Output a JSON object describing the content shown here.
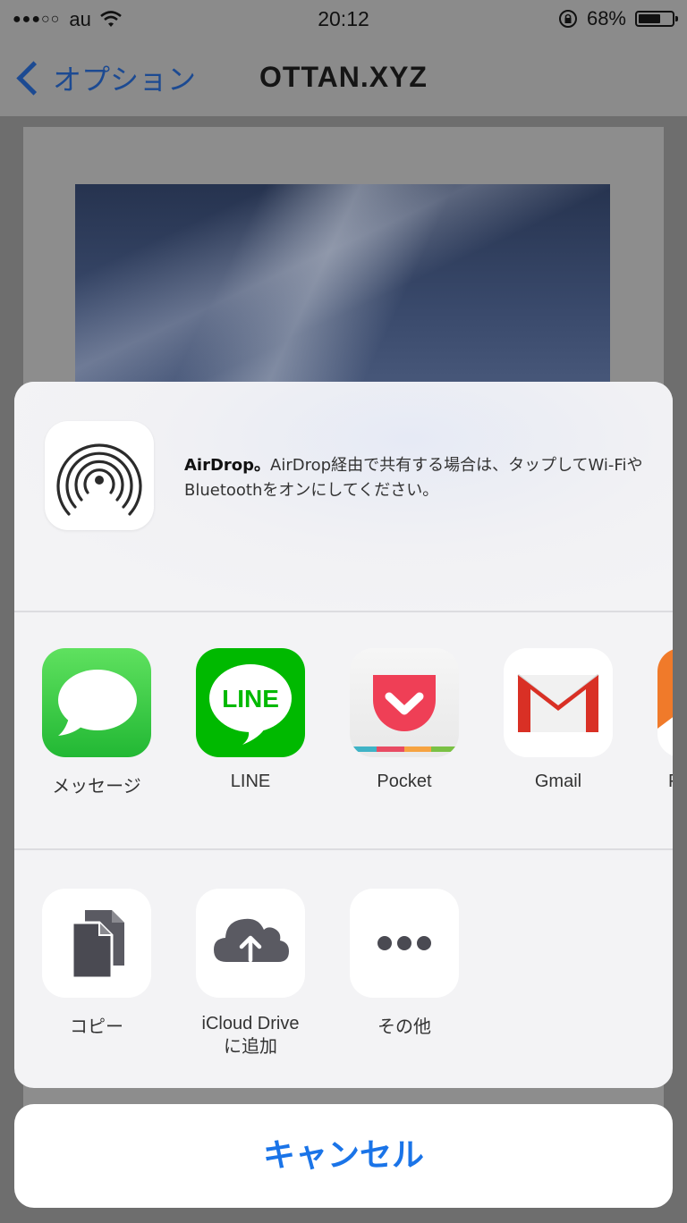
{
  "status_bar": {
    "signal_dots": "●●●○○",
    "carrier": "au",
    "time": "20:12",
    "battery_percent": "68%",
    "battery_level": 0.68
  },
  "nav": {
    "back_label": "オプション",
    "title": "OTTAN.XYZ"
  },
  "airdrop": {
    "title": "AirDrop。",
    "message": "AirDrop経由で共有する場合は、タップしてWi-FiやBluetoothをオンにしてください。"
  },
  "share_apps": [
    {
      "label": "メッセージ",
      "icon": "messages-icon"
    },
    {
      "label": "LINE",
      "icon": "line-icon",
      "icon_text": "LINE"
    },
    {
      "label": "Pocket",
      "icon": "pocket-icon"
    },
    {
      "label": "Gmail",
      "icon": "gmail-icon"
    },
    {
      "label": "PR",
      "icon": "partial-app-icon"
    }
  ],
  "actions": [
    {
      "label": "コピー",
      "icon": "copy-icon"
    },
    {
      "label": "iCloud Drive",
      "label_line2": "に追加",
      "icon": "icloud-upload-icon"
    },
    {
      "label": "その他",
      "icon": "more-icon"
    }
  ],
  "cancel_label": "キャンセル",
  "colors": {
    "accent": "#1a74e8",
    "messages_green": "#3fcf4a",
    "line_green": "#00b900",
    "pocket_red": "#ef3f56",
    "gmail_red": "#d93025"
  }
}
